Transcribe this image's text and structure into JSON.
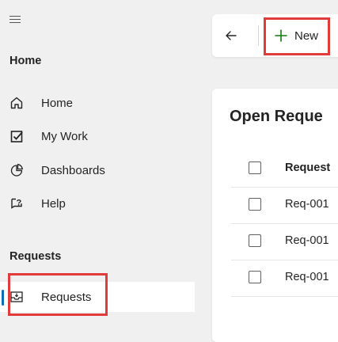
{
  "sidebar": {
    "sections": [
      {
        "label": "Home",
        "items": [
          {
            "label": "Home",
            "icon": "home-icon"
          },
          {
            "label": "My Work",
            "icon": "checkbox-icon"
          },
          {
            "label": "Dashboards",
            "icon": "pie-chart-icon"
          },
          {
            "label": "Help",
            "icon": "help-icon"
          }
        ]
      },
      {
        "label": "Requests",
        "items": [
          {
            "label": "Requests",
            "icon": "inbox-icon",
            "selected": true
          }
        ]
      }
    ]
  },
  "command_bar": {
    "back_icon": "arrow-left-icon",
    "new_label": "New",
    "new_icon": "plus-icon"
  },
  "main": {
    "title": "Open Reque",
    "table": {
      "header": "Request",
      "rows": [
        "Req-001",
        "Req-001",
        "Req-001"
      ]
    }
  },
  "colors": {
    "accent": "#0f6cbd",
    "highlight": "#e23b3b",
    "plus": "#107c10"
  }
}
